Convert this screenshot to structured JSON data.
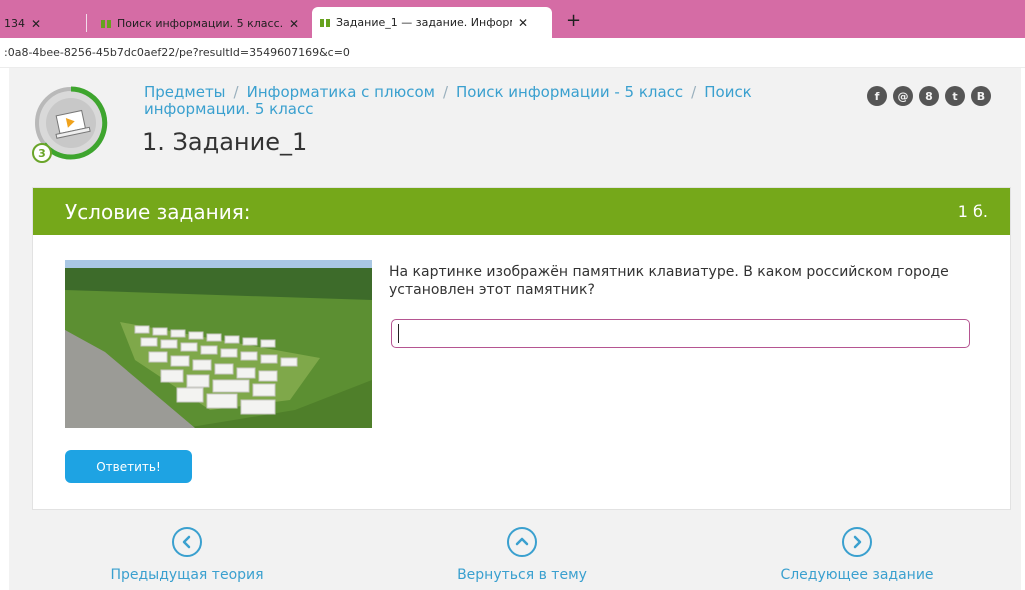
{
  "browser": {
    "tabs": [
      {
        "title": "134"
      },
      {
        "title": "Поиск информации. 5 класс. Ин"
      },
      {
        "title": "Задание_1 — задание. Информ"
      }
    ],
    "new_tab": "+",
    "close_glyph": "✕",
    "url": ":0a8-4bee-8256-45b7dc0aef22/pe?resultId=3549607169&c=0"
  },
  "header": {
    "breadcrumbs": [
      "Предметы",
      "Информатика с плюсом",
      "Поиск информации - 5 класс",
      "Поиск информации. 5 класс"
    ],
    "separator": "/",
    "title": "1. Задание_1",
    "level_badge": "3",
    "social": [
      "f",
      "@",
      "8",
      "t",
      "B"
    ]
  },
  "task": {
    "condition_label": "Условие задания:",
    "points": "1 б.",
    "question": "На картинке изображён памятник клавиатуре. В каком российском городе установлен этот памятник?",
    "answer_value": "",
    "submit_label": "Ответить!"
  },
  "navigation": {
    "prev": "Предыдущая теория",
    "up": "Вернуться в тему",
    "next": "Следующее задание"
  },
  "colors": {
    "accent_green": "#75a81a",
    "link_blue": "#3aa0cf",
    "button_blue": "#1ea3e3",
    "tabbar_pink": "#d56ca5"
  }
}
